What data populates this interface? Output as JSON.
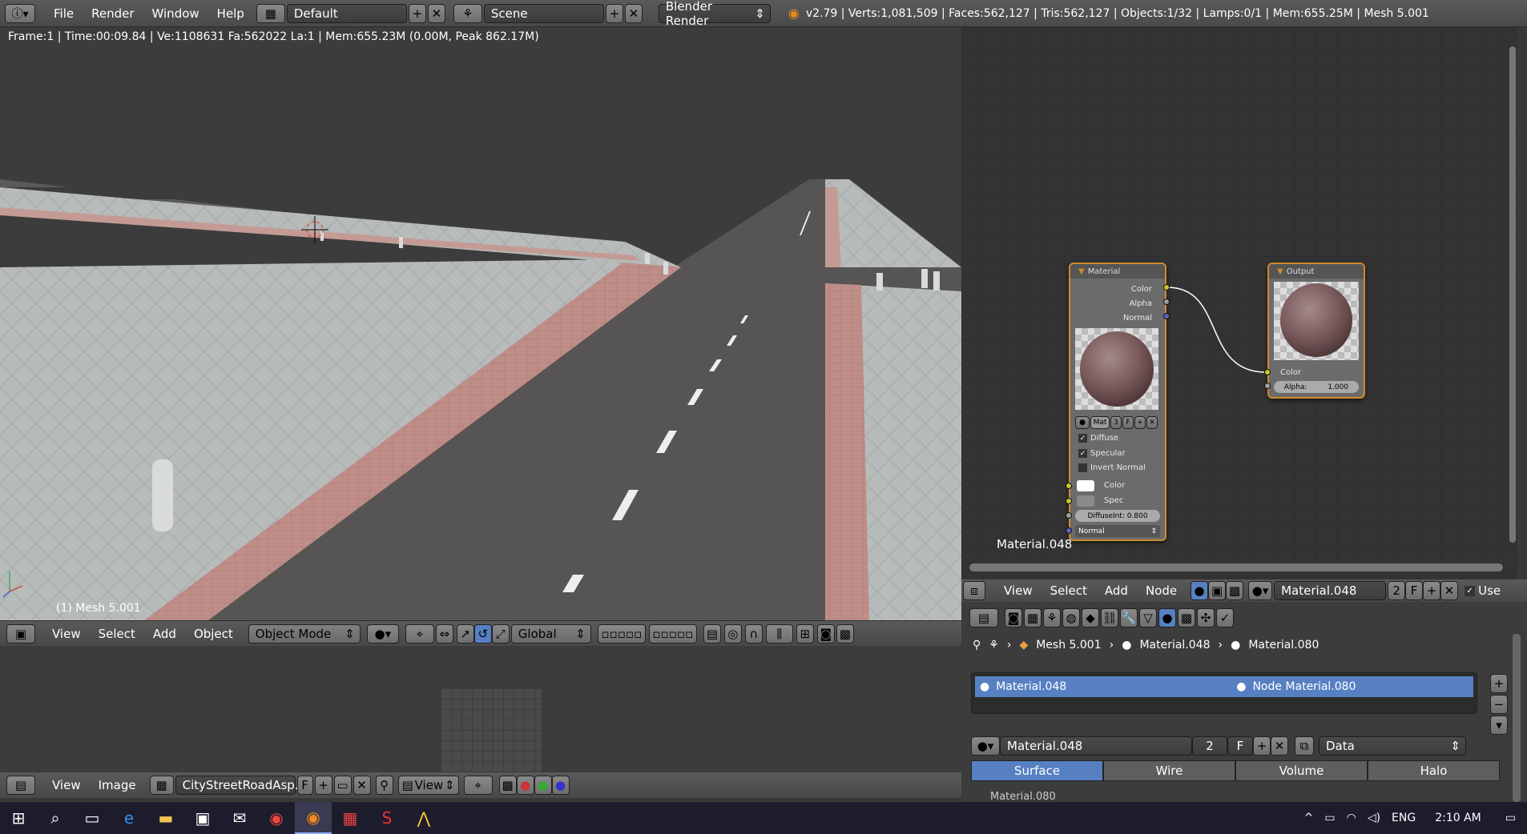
{
  "topbar": {
    "menus": [
      "File",
      "Render",
      "Window",
      "Help"
    ],
    "layout": "Default",
    "scene": "Scene",
    "engine": "Blender Render",
    "stats": "v2.79 | Verts:1,081,509 | Faces:562,127 | Tris:562,127 | Objects:1/32 | Lamps:0/1 | Mem:655.25M | Mesh 5.001"
  },
  "viewport": {
    "info": "Frame:1 | Time:00:09.84 | Ve:1108631 Fa:562022 La:1 | Mem:655.23M (0.00M, Peak 862.17M)",
    "object_label": "(1) Mesh 5.001",
    "menus": [
      "View",
      "Select",
      "Add",
      "Object"
    ],
    "mode": "Object Mode",
    "orientation": "Global"
  },
  "uv_editor": {
    "menus": [
      "View",
      "Image"
    ],
    "image_name": "CityStreetRoadAsp...",
    "fake_user": "F",
    "view_label": "View"
  },
  "node_editor": {
    "material_node": {
      "title": "Material",
      "outputs": [
        "Color",
        "Alpha",
        "Normal"
      ],
      "mat_field": "Mat",
      "mat_users": "3",
      "mat_f": "F",
      "diffuse": "Diffuse",
      "specular": "Specular",
      "invert_normal": "Invert Normal",
      "color_label": "Color",
      "spec_label": "Spec",
      "diffuse_int": "DiffuseInt: 0.800",
      "normal": "Normal"
    },
    "output_node": {
      "title": "Output",
      "color_label": "Color",
      "alpha": "Alpha:",
      "alpha_value": "1.000"
    },
    "material_name_label": "Material.048",
    "header_menus": [
      "View",
      "Select",
      "Add",
      "Node"
    ],
    "material_field": "Material.048",
    "users": "2",
    "fake": "F",
    "use_label": "Use"
  },
  "properties": {
    "breadcrumb": [
      "Mesh 5.001",
      "Material.048",
      "Material.080"
    ],
    "slots": [
      {
        "name": "Material.048",
        "node": "Node Material.080"
      }
    ],
    "material_field": "Material.048",
    "users": "2",
    "fake": "F",
    "link": "Data",
    "tabs": [
      "Surface",
      "Wire",
      "Volume",
      "Halo"
    ],
    "next_item": "Material.080"
  },
  "taskbar": {
    "lang": "ENG",
    "time": "2:10 AM"
  },
  "colors": {
    "accent_blue": "#5680c2",
    "node_border": "#d08a2c",
    "taskbar": "#1c1c2c"
  }
}
